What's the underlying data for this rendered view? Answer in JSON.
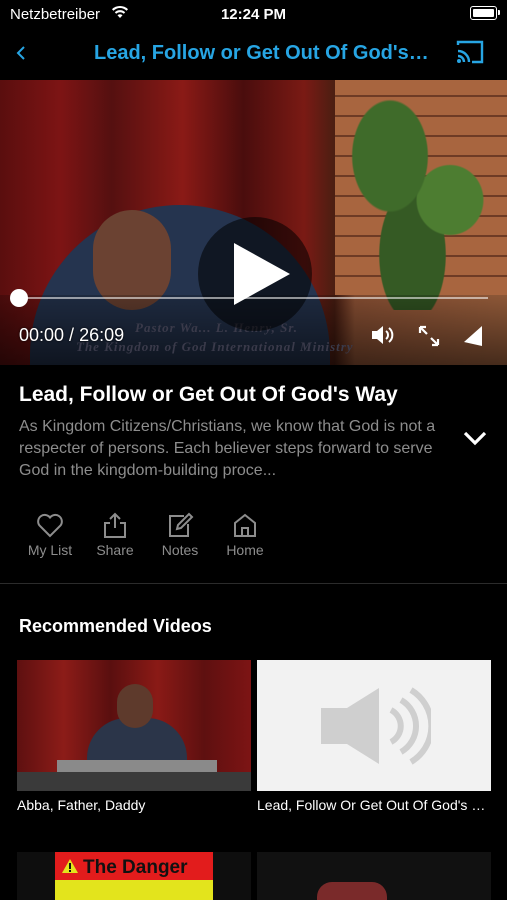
{
  "status_bar": {
    "carrier": "Netzbetreiber",
    "time": "12:24 PM"
  },
  "nav": {
    "title": "Lead, Follow or Get Out Of God's Way"
  },
  "player": {
    "current_time": "00:00",
    "separator": " / ",
    "duration": "26:09",
    "progress": 0,
    "overlay_caption_line1": "Pastor Wa... L. Henry, Sr.",
    "overlay_caption_line2": "The Kingdom of God International Ministry"
  },
  "video": {
    "title": "Lead, Follow or Get Out Of God's Way",
    "description": "As Kingdom Citizens/Christians, we know that God is not a respecter of persons. Each believer steps forward to serve God in the kingdom-building proce..."
  },
  "actions": [
    {
      "label": "My List",
      "icon": "heart-icon"
    },
    {
      "label": "Share",
      "icon": "share-icon"
    },
    {
      "label": "Notes",
      "icon": "notes-icon"
    },
    {
      "label": "Home",
      "icon": "home-icon"
    }
  ],
  "recommended": {
    "heading": "Recommended Videos",
    "items": [
      {
        "title": "Abba, Father, Daddy"
      },
      {
        "title": "Lead, Follow Or Get Out Of God's Way"
      },
      {
        "title": "The Danger"
      },
      {
        "title": ""
      }
    ]
  },
  "colors": {
    "accent": "#27a5e3",
    "background": "#000000",
    "muted_text": "#8d8d8d"
  }
}
